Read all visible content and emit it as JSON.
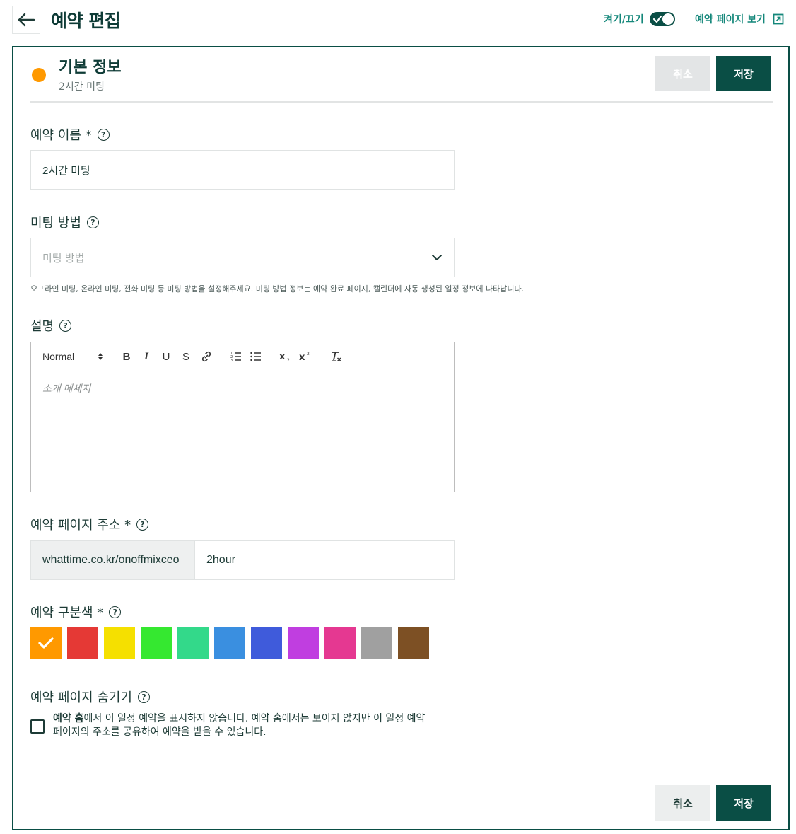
{
  "header": {
    "title": "예약 편집",
    "toggle_label": "켜기/끄기",
    "toggle_on": true,
    "preview_link": "예약 페이지 보기"
  },
  "section": {
    "title": "기본 정보",
    "subtitle": "2시간 미팅",
    "dot_color": "#ff9900",
    "cancel_label": "취소",
    "save_label": "저장"
  },
  "fields": {
    "name": {
      "label": "예약 이름 *",
      "value": "2시간 미팅"
    },
    "method": {
      "label": "미팅 방법",
      "placeholder": "미팅 방법",
      "hint": "오프라인 미팅, 온라인 미팅, 전화 미팅 등 미팅 방법을 설정해주세요. 미팅 방법 정보는 예약 완료 페이지, 캘린더에 자동 생성된 일정 정보에 나타납니다."
    },
    "description": {
      "label": "설명",
      "format_select": "Normal",
      "placeholder": "소개 메세지"
    },
    "url": {
      "label": "예약 페이지 주소 *",
      "prefix": "whattime.co.kr/onoffmixceo",
      "value": "2hour"
    },
    "color": {
      "label": "예약 구분색 *",
      "selected_index": 0,
      "options": [
        "#ff9900",
        "#e53935",
        "#f5e000",
        "#35e830",
        "#33d98a",
        "#3a8fe0",
        "#3f5bdb",
        "#c03ee0",
        "#e53891",
        "#a0a0a0",
        "#7d5024"
      ]
    },
    "hide": {
      "label": "예약 페이지 숨기기",
      "checked": false,
      "text_bold": "예약 홈",
      "text_line1": "에서 이 일정 예약을 표시하지 않습니다. 예약 홈에서는 보이지 않지만 이 일정 예약",
      "text_line2": "페이지의 주소를 공유하여 예약을 받을 수 있습니다."
    }
  },
  "footer": {
    "cancel_label": "취소",
    "save_label": "저장"
  },
  "theme": {
    "primary": "#0a4e45",
    "accent_text": "#14877a"
  }
}
